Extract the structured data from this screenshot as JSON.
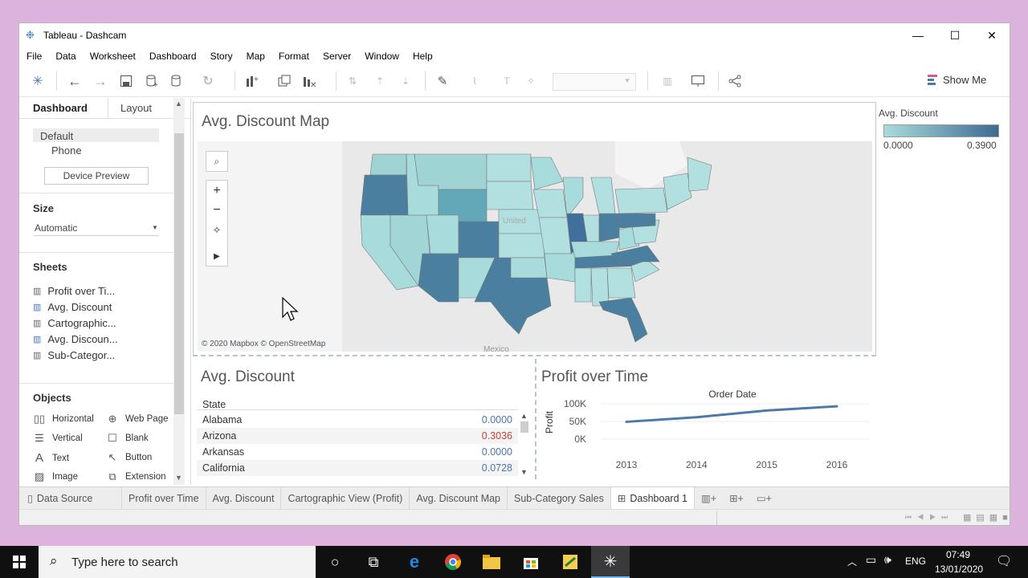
{
  "window": {
    "title": "Tableau - Dashcam"
  },
  "menu": [
    "File",
    "Data",
    "Worksheet",
    "Dashboard",
    "Story",
    "Map",
    "Format",
    "Server",
    "Window",
    "Help"
  ],
  "toolbar": {
    "show_me": "Show Me"
  },
  "left_pane": {
    "tabs": {
      "dashboard": "Dashboard",
      "layout": "Layout"
    },
    "devices": [
      "Default",
      "Phone"
    ],
    "device_preview": "Device Preview",
    "size_header": "Size",
    "size_value": "Automatic",
    "sheets_header": "Sheets",
    "sheets": [
      "Profit over Ti...",
      "Avg. Discount",
      "Cartographic...",
      "Avg. Discoun...",
      "Sub-Categor..."
    ],
    "objects_header": "Objects",
    "objects": [
      {
        "label": "Horizontal",
        "icon": "horizontal-container-icon"
      },
      {
        "label": "Web Page",
        "icon": "globe-icon"
      },
      {
        "label": "Vertical",
        "icon": "vertical-container-icon"
      },
      {
        "label": "Blank",
        "icon": "blank-icon"
      },
      {
        "label": "Text",
        "icon": "text-icon"
      },
      {
        "label": "Button",
        "icon": "button-icon"
      },
      {
        "label": "Image",
        "icon": "image-icon"
      },
      {
        "label": "Extension",
        "icon": "extension-icon"
      }
    ]
  },
  "map_view": {
    "title": "Avg. Discount Map",
    "attribution": "© 2020 Mapbox © OpenStreetMap",
    "mexico_label": "Mexico",
    "us_label": "United"
  },
  "legend": {
    "title": "Avg. Discount",
    "min": "0.0000",
    "max": "0.3900",
    "color_low": "#a8dcdc",
    "color_high": "#3e6a92"
  },
  "table_view": {
    "title": "Avg. Discount",
    "column_header": "State",
    "rows": [
      {
        "state": "Alabama",
        "value": "0.0000",
        "color": "#4a76b4"
      },
      {
        "state": "Arizona",
        "value": "0.3036",
        "color": "#d33a3a"
      },
      {
        "state": "Arkansas",
        "value": "0.0000",
        "color": "#4a76b4"
      },
      {
        "state": "California",
        "value": "0.0728",
        "color": "#4a76b4"
      }
    ]
  },
  "profit_view": {
    "title": "Profit over Time",
    "chart_data": {
      "type": "line",
      "xlabel": "Order Date",
      "ylabel": "Profit",
      "categories": [
        "2013",
        "2014",
        "2015",
        "2016"
      ],
      "series": [
        {
          "values": [
            49000,
            62000,
            81000,
            93000
          ]
        }
      ],
      "ylim": [
        0,
        100000
      ],
      "yticks": [
        "100K",
        "50K",
        "0K"
      ],
      "line_color": "#4e79a7"
    }
  },
  "tabs": [
    {
      "label": "Data Source",
      "active": false
    },
    {
      "label": "Profit over Time",
      "active": false
    },
    {
      "label": "Avg. Discount",
      "active": false
    },
    {
      "label": "Cartographic View (Profit)",
      "active": false
    },
    {
      "label": "Avg. Discount Map",
      "active": false
    },
    {
      "label": "Sub-Category Sales",
      "active": false
    },
    {
      "label": "Dashboard 1",
      "active": true
    }
  ],
  "taskbar": {
    "search_placeholder": "Type here to search",
    "language": "ENG",
    "time": "07:49",
    "date": "13/01/2020"
  }
}
